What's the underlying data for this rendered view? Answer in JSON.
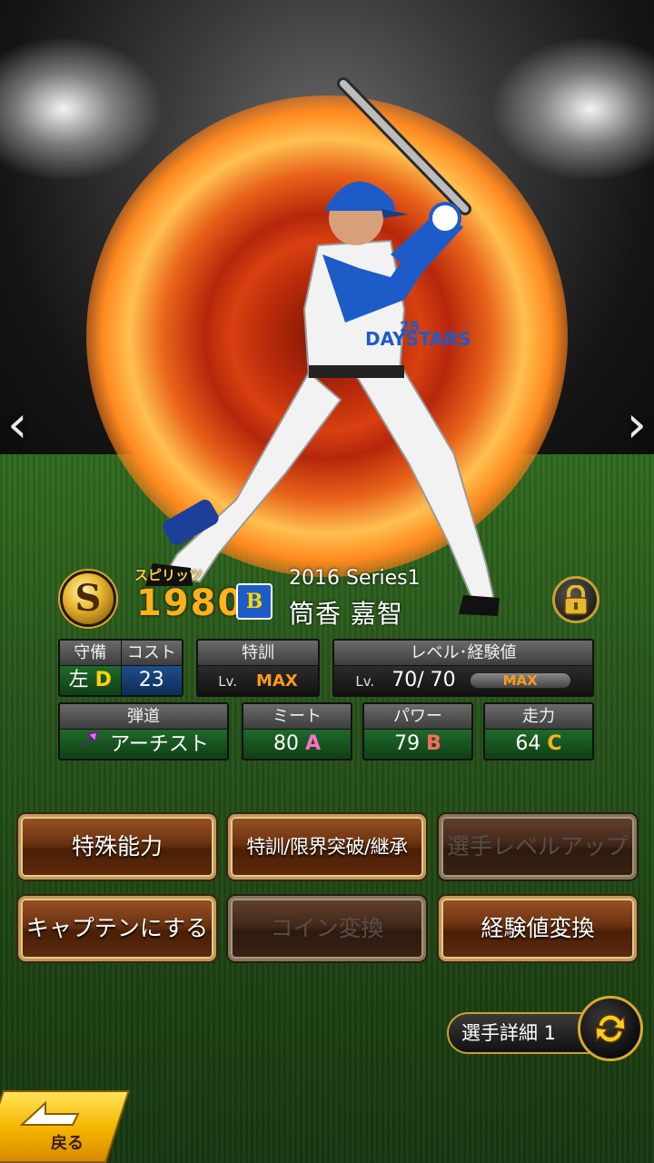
{
  "navigation": {
    "prev_icon": "chevron-left-icon",
    "next_icon": "chevron-right-icon"
  },
  "card": {
    "rarity": "S",
    "spirits_label": "スピリッツ",
    "spirits": "1980",
    "team_logo": "B",
    "series": "2016 Series1",
    "player_name": "筒香 嘉智",
    "jersey_text": "DAYSTARS",
    "jersey_number": "25",
    "lock_icon": "padlock-icon"
  },
  "stats": {
    "defense_label": "守備",
    "defense_hand": "左",
    "defense_grade": "D",
    "cost_label": "コスト",
    "cost": "23",
    "training_label": "特訓",
    "training_lv": "Lv.",
    "training_value": "MAX",
    "level_label": "レベル･経験値",
    "level_lv": "Lv.",
    "level_current": "70",
    "level_sep": "/",
    "level_max": "70",
    "exp_text": "MAX",
    "trajectory_label": "弾道",
    "trajectory_value": "アーチスト",
    "meet_label": "ミート",
    "meet_value": "80",
    "meet_grade": "A",
    "power_label": "パワー",
    "power_value": "79",
    "power_grade": "B",
    "speed_label": "走力",
    "speed_value": "64",
    "speed_grade": "C"
  },
  "buttons": {
    "special_ability": "特殊能力",
    "training_limit": "特訓/限界突破/継承",
    "level_up": "選手レベルアップ",
    "make_captain": "キャプテンにする",
    "coin_exchange": "コイン変換",
    "exp_exchange": "経験値変換"
  },
  "footer": {
    "detail_tab": "選手詳細 1",
    "back": "戻る"
  },
  "colors": {
    "accent_gold": "#d8a830",
    "button_brown": "#6a3210",
    "max_orange": "#ff9a1a"
  }
}
